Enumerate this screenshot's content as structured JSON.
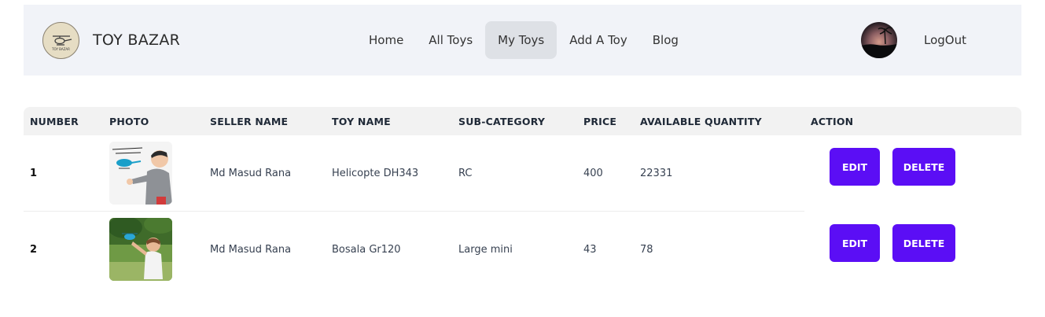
{
  "brand": {
    "name": "TOY BAZAR",
    "logo_text": "TOY BAZAR"
  },
  "nav": {
    "links": [
      "Home",
      "All Toys",
      "My Toys",
      "Add A Toy",
      "Blog"
    ],
    "active": "My Toys",
    "logout": "LogOut"
  },
  "table": {
    "headers": [
      "NUMBER",
      "PHOTO",
      "SELLER NAME",
      "TOY NAME",
      "SUB-CATEGORY",
      "PRICE",
      "AVAILABLE QUANTITY",
      "ACTION"
    ],
    "rows": [
      {
        "number": "1",
        "photo": "helicopter-toy-photo",
        "seller": "Md Masud Rana",
        "toy": "Helicopte DH343",
        "subcategory": "RC",
        "price": "400",
        "quantity": "22331",
        "edit": "EDIT",
        "delete": "DELETE"
      },
      {
        "number": "2",
        "photo": "outdoor-toy-photo",
        "seller": "Md Masud Rana",
        "toy": "Bosala Gr120",
        "subcategory": "Large mini",
        "price": "43",
        "quantity": "78",
        "edit": "EDIT",
        "delete": "DELETE"
      }
    ]
  },
  "colors": {
    "nav_bg": "#f1f3f8",
    "active_bg": "#dee1e6",
    "header_bg": "#f2f2f2",
    "button": "#5b0ef5"
  }
}
